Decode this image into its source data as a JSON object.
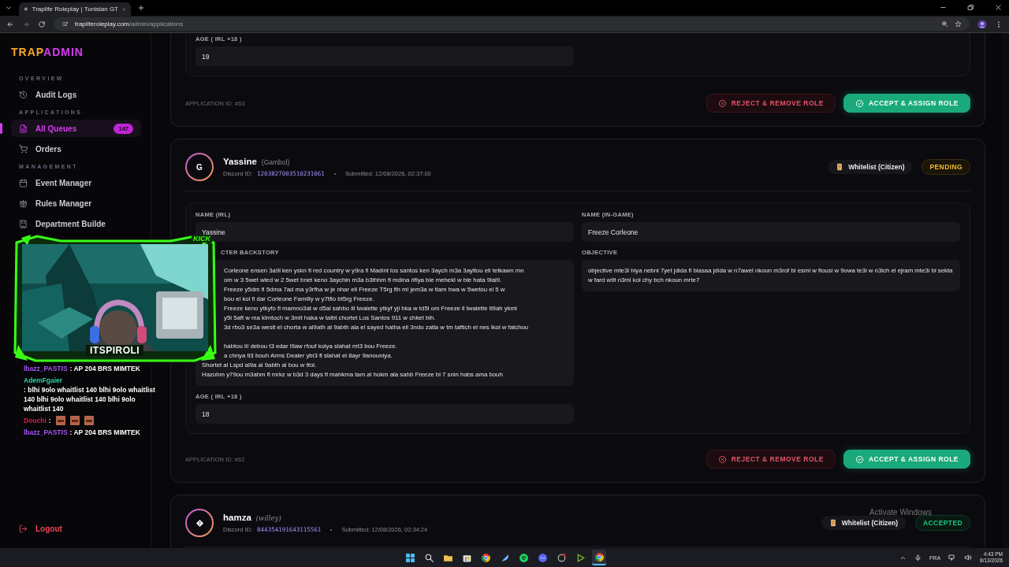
{
  "browser": {
    "tab_title": "Traplife Roleplay | Tunisian GT",
    "url_host": "trapliferoleplay.com",
    "url_path": "/admin/applications"
  },
  "sidebar": {
    "logo": [
      "TRAP",
      "ADMIN"
    ],
    "sections": [
      {
        "heading": "OVERVIEW",
        "items": [
          {
            "kind": "history",
            "label": "Audit Logs",
            "selected": false
          }
        ]
      },
      {
        "heading": "APPLICATIONS",
        "items": [
          {
            "kind": "file",
            "label": "All Queues",
            "selected": true,
            "badge": "147"
          },
          {
            "kind": "cart",
            "label": "Orders",
            "selected": false
          }
        ]
      },
      {
        "heading": "MANAGEMENT",
        "items": [
          {
            "kind": "calendar",
            "label": "Event Manager",
            "selected": false
          },
          {
            "kind": "scales",
            "label": "Rules Manager",
            "selected": false
          },
          {
            "kind": "building",
            "label": "Department Builde",
            "selected": false
          }
        ]
      }
    ],
    "logout": "Logout"
  },
  "applications": [
    {
      "fields": [
        {
          "kind": "short",
          "label": "AGE ( IRL +18 )",
          "value": "19"
        }
      ],
      "application_id": "APPLICATION ID: #63",
      "actions": [
        {
          "kind": "reject",
          "label": "REJECT & REMOVE ROLE"
        },
        {
          "kind": "accept",
          "label": "ACCEPT & ASSIGN ROLE"
        }
      ]
    },
    {
      "avatar": "G",
      "name": "Yassine",
      "alias": "(Gambol)",
      "discord_label": "Discord ID:",
      "discord_id": "1203827003510231061",
      "submitted": "Submitted: 12/08/2026, 02:37:00",
      "role": "Whitelist (Citizen)",
      "status": {
        "kind": "pending",
        "label": "PENDING"
      },
      "fields": [
        {
          "kind": "short",
          "label": "NAME (IRL)",
          "value": "Yassine"
        },
        {
          "kind": "short",
          "label": "NAME (IN-GAME)",
          "value": "Freeze Corleone"
        },
        {
          "kind": "lines",
          "label": "CTER BACKSTORY",
          "lines": [
            "Corleone ensen 3a9l ken yskn fi red country w y9ra fi Madint los santos ken 3aych m3a 3ayltou eli tetkawn mn",
            "om w 3 5wet wled w 2 5wet bnet keno 3aychin m3a b3thhm fi mdina rifiya ble mehekl w ble hata 9lal9.",
            "Freeze y5dm fi 5dma 7ad ma y3rfha w je nhar eli Freeze T5rg fih ml jem3a w tlam hwa w 5wetou el 5 w",
            "bou el kol fi dar Corleone Familly w y7tflo bt5rg Freeze.",
            "Freeze keno ytkyfo fl mamno3at w d5al sahbo lil twalette ytkyf yji hka w td5l om Freeze ll twalette tl9ah ykmi",
            "y5i 5aft w ma klmtoch w 3mlt haka w talbt chortet Los Santos 911 w chket bih.",
            "3d rbo3 se3a weslt el chorta w al9ath al 9abth ala el sayed hatha eli 3ndo zatla w tm taftich el nes lkol w fatchou",
            "habtou lil debou t3 edar l9aw rfouf kolya slahat mt3 bou Freeze.",
            "a chnya tl3 bouh Arms Dealer ybi3 fl slahat el 8ayr 9anouniya.",
            "Shortet al Lspd al9a al 9abth al bou w tfol.",
            "Hazohm y79ou m3ahm fl mrkz w b3d 3 days fl mahkma tam al hokm ala sahb Freeze bi 7 snin habs ama bouh"
          ]
        },
        {
          "kind": "text",
          "label": "OBJECTIVE",
          "value": "objective mte3i hiya nebni 7yet jdida fi blasaa jdida w n7awel nkoun m3rof bi esmi w flousi w 9owa te3i w n3ich el ejram mte3i bi sekta w fard w9t n3ml kol chy bch nkoun mrte7"
        },
        {
          "kind": "short",
          "label": "AGE ( IRL +18 )",
          "value": "18"
        }
      ],
      "application_id": "APPLICATION ID: #62",
      "actions": [
        {
          "kind": "reject",
          "label": "REJECT & REMOVE ROLE"
        },
        {
          "kind": "accept",
          "label": "ACCEPT & ASSIGN ROLE"
        }
      ]
    },
    {
      "name": "hamza",
      "alias": "(willey)",
      "discord_label": "Discord ID:",
      "discord_id": "844354191643115561",
      "submitted": "Submitted: 12/08/2026, 02:34:24",
      "role": "Whitelist (Citizen)",
      "status": {
        "kind": "accepted",
        "label": "ACCEPTED"
      }
    }
  ],
  "stream_overlay": {
    "streamer": "ITSPIROLI",
    "platform": "KICK",
    "chat": [
      {
        "user": "lbazz_PASTIS",
        "color": "#a855f7",
        "message": ": AP 204 BRS MIMTEK"
      },
      {
        "user": "AdemFgaier",
        "color": "#2dd4a0",
        "message": ": blhi 9olo whaitlist 140 blhi 9olo whaitlist 140 blhi 9olo whaitlist 140 blhi 9olo whaitlist 140"
      },
      {
        "user": "Douchi",
        "color": "#e11d48",
        "message": ":",
        "kind": "emotes"
      },
      {
        "user": "lbazz_PASTIS",
        "color": "#a855f7",
        "message": ": AP 204 BRS MIMTEK"
      }
    ]
  },
  "os_notice": "Activate Windows",
  "taskbar": {
    "apps": [
      {
        "kind": "windows",
        "selected": false
      },
      {
        "kind": "search",
        "selected": false
      },
      {
        "kind": "folder",
        "selected": false
      },
      {
        "kind": "store",
        "selected": false
      },
      {
        "kind": "chrome",
        "selected": false
      },
      {
        "kind": "feather",
        "selected": false
      },
      {
        "kind": "spotify",
        "selected": false
      },
      {
        "kind": "discord",
        "selected": false
      },
      {
        "kind": "ring",
        "selected": false
      },
      {
        "kind": "play",
        "selected": false
      },
      {
        "kind": "chrome",
        "selected": true
      }
    ],
    "language": "FRA",
    "time": "4:43 PM",
    "date": "8/13/2026"
  }
}
